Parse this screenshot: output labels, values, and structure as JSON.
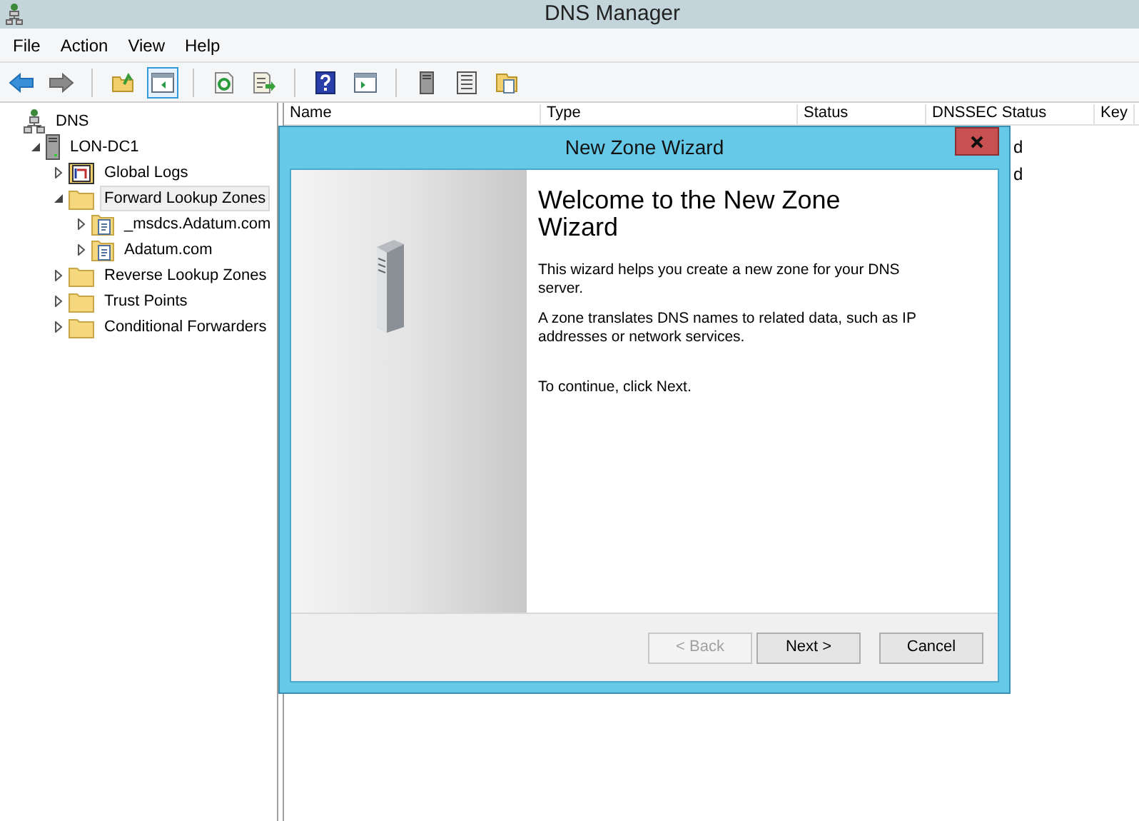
{
  "window": {
    "title": "DNS Manager"
  },
  "menu": [
    "File",
    "Action",
    "View",
    "Help"
  ],
  "toolbar": [
    {
      "kind": "back"
    },
    {
      "kind": "forward"
    },
    {
      "kind": "sep"
    },
    {
      "kind": "up"
    },
    {
      "kind": "pane",
      "selected": true
    },
    {
      "kind": "sep"
    },
    {
      "kind": "refresh"
    },
    {
      "kind": "export"
    },
    {
      "kind": "sep"
    },
    {
      "kind": "help"
    },
    {
      "kind": "pane2"
    },
    {
      "kind": "sep"
    },
    {
      "kind": "server"
    },
    {
      "kind": "list"
    },
    {
      "kind": "docs"
    }
  ],
  "tree": [
    {
      "label": "DNS",
      "kind": "dns",
      "selected": false,
      "children": [
        {
          "label": "LON-DC1",
          "kind": "server",
          "expanded": true,
          "selected": false,
          "children": [
            {
              "label": "Global Logs",
              "kind": "logs",
              "expanded": false,
              "selected": false
            },
            {
              "label": "Forward Lookup Zones",
              "kind": "folder",
              "expanded": true,
              "selected": true,
              "children": [
                {
                  "label": "_msdcs.Adatum.com",
                  "kind": "zone",
                  "expanded": false,
                  "selected": false
                },
                {
                  "label": "Adatum.com",
                  "kind": "zone",
                  "expanded": false,
                  "selected": false
                }
              ]
            },
            {
              "label": "Reverse Lookup Zones",
              "kind": "folder",
              "expanded": false,
              "selected": false
            },
            {
              "label": "Trust Points",
              "kind": "folder",
              "expanded": false,
              "selected": false
            },
            {
              "label": "Conditional Forwarders",
              "kind": "folder",
              "expanded": false,
              "selected": false
            }
          ]
        }
      ]
    }
  ],
  "table": {
    "columns": [
      "Name",
      "Type",
      "Status",
      "DNSSEC Status",
      "Key"
    ],
    "rows": [
      {
        "dnssec_status": "d"
      },
      {
        "dnssec_status": "d"
      }
    ]
  },
  "dialog": {
    "title": "New Zone Wizard",
    "heading": "Welcome to the New Zone Wizard",
    "paragraphs": [
      "This wizard helps you create a new zone for your DNS server.",
      "A zone translates DNS names to related data, such as IP addresses or network services.",
      "To continue, click Next."
    ],
    "buttons": [
      {
        "label": "< Back",
        "disabled": true
      },
      {
        "label": "Next >",
        "disabled": false
      },
      {
        "label": "Cancel",
        "disabled": false
      }
    ]
  }
}
